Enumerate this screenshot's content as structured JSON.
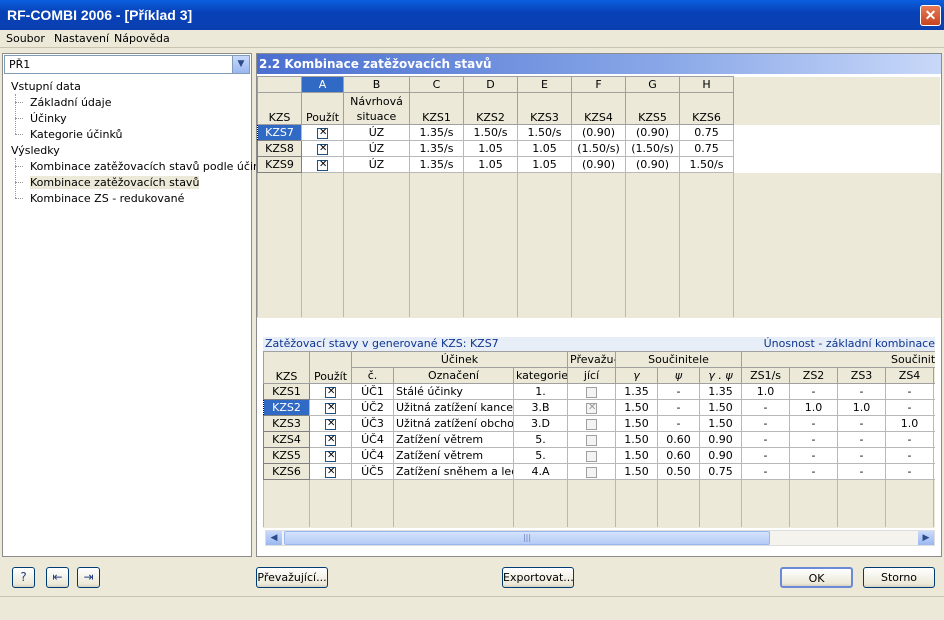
{
  "window": {
    "title": "RF-COMBI 2006 - [Příklad 3]"
  },
  "menu": [
    "Soubor",
    "Nastavení",
    "Nápověda"
  ],
  "combo": {
    "value": "PŘ1"
  },
  "tree": {
    "input": "Vstupní data",
    "input_items": [
      "Základní údaje",
      "Účinky",
      "Kategorie účinků"
    ],
    "results": "Výsledky",
    "result_items": [
      "Kombinace zatěžovacích stavů podle účinků",
      "Kombinace zatěžovacích stavů",
      "Kombinace ZS - redukované"
    ]
  },
  "section": {
    "title": "2.2 Kombinace zatěžovacích stavů"
  },
  "upper": {
    "letters": [
      "A",
      "B",
      "C",
      "D",
      "E",
      "F",
      "G",
      "H"
    ],
    "row_header": "KZS",
    "headers": [
      "Použít",
      "Návrhová situace",
      "KZS1",
      "KZS2",
      "KZS3",
      "KZS4",
      "KZS5",
      "KZS6"
    ],
    "rows": [
      {
        "id": "KZS7",
        "use": true,
        "situation": "ÚZ",
        "v": [
          "1.35/s",
          "1.50/s",
          "1.50/s",
          "(0.90)",
          "(0.90)",
          "0.75"
        ]
      },
      {
        "id": "KZS8",
        "use": true,
        "situation": "ÚZ",
        "v": [
          "1.35/s",
          "1.05",
          "1.05",
          "(1.50/s)",
          "(1.50/s)",
          "0.75"
        ]
      },
      {
        "id": "KZS9",
        "use": true,
        "situation": "ÚZ",
        "v": [
          "1.35/s",
          "1.05",
          "1.05",
          "(0.90)",
          "(0.90)",
          "1.50/s"
        ]
      }
    ]
  },
  "lower": {
    "title_left": "Zatěžovací stavy v generované KZS: KZS7",
    "title_right": "Únosnost - základní kombinace",
    "h_ucinek": "Účinek",
    "h_prev1": "Převažu-",
    "h_prev2": "jící",
    "h_souc": "Součinitele",
    "h_souc2": "Součinitele z",
    "h_kzs": "KZS",
    "h_pouzit": "Použít",
    "h_c": "č.",
    "h_ozn": "Označení",
    "h_kat": "kategorie",
    "h_gamma": "γ",
    "h_psi": "ψ",
    "h_gp": "γ . ψ",
    "h_zs": [
      "ZS1/s",
      "ZS2",
      "ZS3",
      "ZS4"
    ],
    "rows": [
      {
        "id": "KZS1",
        "use": true,
        "c": "ÚČ1",
        "name": "Stálé účinky",
        "cat": "1.",
        "prev": false,
        "g": "1.35",
        "psi": "-",
        "gp": "1.35",
        "zs": [
          "1.0",
          "-",
          "-",
          "-"
        ]
      },
      {
        "id": "KZS2",
        "use": true,
        "c": "ÚČ2",
        "name": "Užitná zatížení kancel",
        "cat": "3.B",
        "prev": true,
        "g": "1.50",
        "psi": "-",
        "gp": "1.50",
        "zs": [
          "-",
          "1.0",
          "1.0",
          "-"
        ]
      },
      {
        "id": "KZS3",
        "use": true,
        "c": "ÚČ3",
        "name": "Užitná zatížení obchod",
        "cat": "3.D",
        "prev": false,
        "g": "1.50",
        "psi": "-",
        "gp": "1.50",
        "zs": [
          "-",
          "-",
          "-",
          "1.0"
        ]
      },
      {
        "id": "KZS4",
        "use": true,
        "c": "ÚČ4",
        "name": "Zatížení větrem",
        "cat": "5.",
        "prev": false,
        "g": "1.50",
        "psi": "0.60",
        "gp": "0.90",
        "zs": [
          "-",
          "-",
          "-",
          "-"
        ]
      },
      {
        "id": "KZS5",
        "use": true,
        "c": "ÚČ4",
        "name": "Zatížení větrem",
        "cat": "5.",
        "prev": false,
        "g": "1.50",
        "psi": "0.60",
        "gp": "0.90",
        "zs": [
          "-",
          "-",
          "-",
          "-"
        ]
      },
      {
        "id": "KZS6",
        "use": true,
        "c": "ÚČ5",
        "name": "Zatížení sněhem a led",
        "cat": "4.A",
        "prev": false,
        "g": "1.50",
        "psi": "0.50",
        "gp": "0.75",
        "zs": [
          "-",
          "-",
          "-",
          "-"
        ]
      }
    ]
  },
  "buttons": {
    "prevazujici": "Převažující...",
    "export": "Exportovat...",
    "ok": "OK",
    "cancel": "Storno"
  },
  "icons": [
    "help-icon",
    "prev-window-icon",
    "next-window-icon"
  ]
}
